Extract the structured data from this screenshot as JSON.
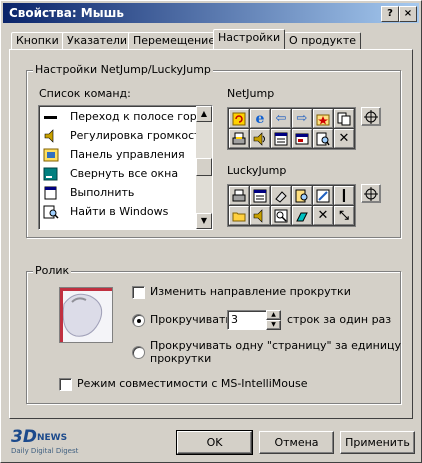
{
  "window": {
    "title": "Свойства: Мышь",
    "help_label": "?",
    "close_label": "×"
  },
  "tabs": [
    {
      "label": "Кнопки"
    },
    {
      "label": "Указатели"
    },
    {
      "label": "Перемещение"
    },
    {
      "label": "Настройки"
    },
    {
      "label": "О продукте"
    }
  ],
  "active_tab": "Настройки",
  "netjump_group": {
    "title": "Настройки NetJump/LuckyJump",
    "list_label": "Список команд:",
    "commands": [
      {
        "label": "Переход к полосе горизо",
        "icon": "bar-icon"
      },
      {
        "label": "Регулировка громкости",
        "icon": "speaker-icon"
      },
      {
        "label": "Панель управления",
        "icon": "control-panel-icon"
      },
      {
        "label": "Свернуть все окна",
        "icon": "minimize-windows-icon"
      },
      {
        "label": "Выполнить",
        "icon": "run-icon"
      },
      {
        "label": "Найти в Windows",
        "icon": "find-icon"
      }
    ],
    "netjump_label": "NetJump",
    "netjump_tools": [
      "refresh-icon",
      "ie-icon",
      "back-arrow-icon",
      "forward-arrow-icon",
      "favorites-icon",
      "copy-icon",
      "print-icon",
      "speaker-icon",
      "list-icon",
      "calculator-icon",
      "find-icon",
      "close-icon"
    ],
    "luckyjump_label": "LuckyJump",
    "luckyjump_tools": [
      "print-icon",
      "list-icon",
      "eraser-icon",
      "find-icon",
      "edit-icon",
      "exclamation-icon",
      "folder-icon",
      "speaker-icon",
      "search-icon",
      "paint-icon",
      "close-icon",
      "resize-icon"
    ],
    "crosshair_icon": "crosshair-icon"
  },
  "wheel_group": {
    "title": "Ролик",
    "reverse_scroll_label": "Изменить направление прокрутки",
    "reverse_scroll_checked": false,
    "scroll_lines_label": "Прокручивать",
    "scroll_lines_value": "3",
    "scroll_lines_suffix": "строк за один раз",
    "scroll_page_label": "Прокручивать одну \"страницу\" за единицу прокрутки",
    "scroll_page_line1": "Прокручивать одну \"страницу\" за единицу",
    "scroll_page_line2": "прокрутки",
    "selected_option": "lines",
    "intellimouse_label": "Режим совместимости с MS-IntelliMouse",
    "intellimouse_checked": false
  },
  "buttons": {
    "ok": "OK",
    "cancel": "Отмена",
    "apply": "Применить"
  },
  "watermark": {
    "logo": "3DNews",
    "tagline": "Daily Digital Digest"
  }
}
